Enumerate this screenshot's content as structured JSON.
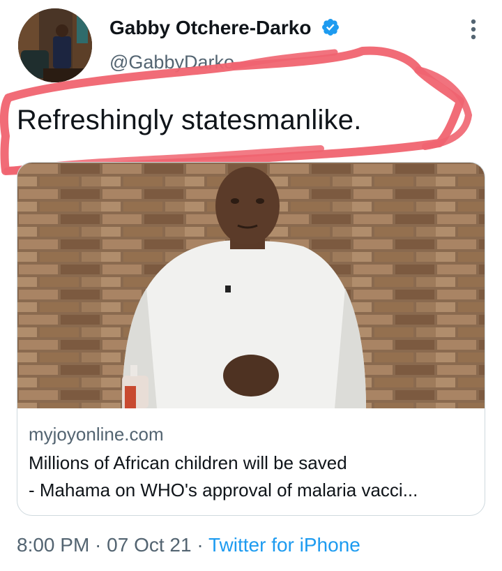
{
  "author": {
    "display_name": "Gabby Otchere-Darko",
    "handle": "@GabbyDarko",
    "verified": true
  },
  "tweet": {
    "text": "Refreshingly statesmanlike."
  },
  "link_card": {
    "domain": "myjoyonline.com",
    "title_line_1": "Millions of African children will be saved",
    "title_line_2": "- Mahama on WHO's approval of malaria vacci..."
  },
  "meta": {
    "time": "8:00 PM",
    "separator_1": " · ",
    "date": "07 Oct 21",
    "separator_2": " · ",
    "source": "Twitter for iPhone"
  },
  "icons": {
    "verified": "verified-badge-icon",
    "more": "more-options-icon"
  },
  "colors": {
    "accent": "#1d9bf0",
    "secondary_text": "#536471",
    "annotation": "#f06470"
  }
}
